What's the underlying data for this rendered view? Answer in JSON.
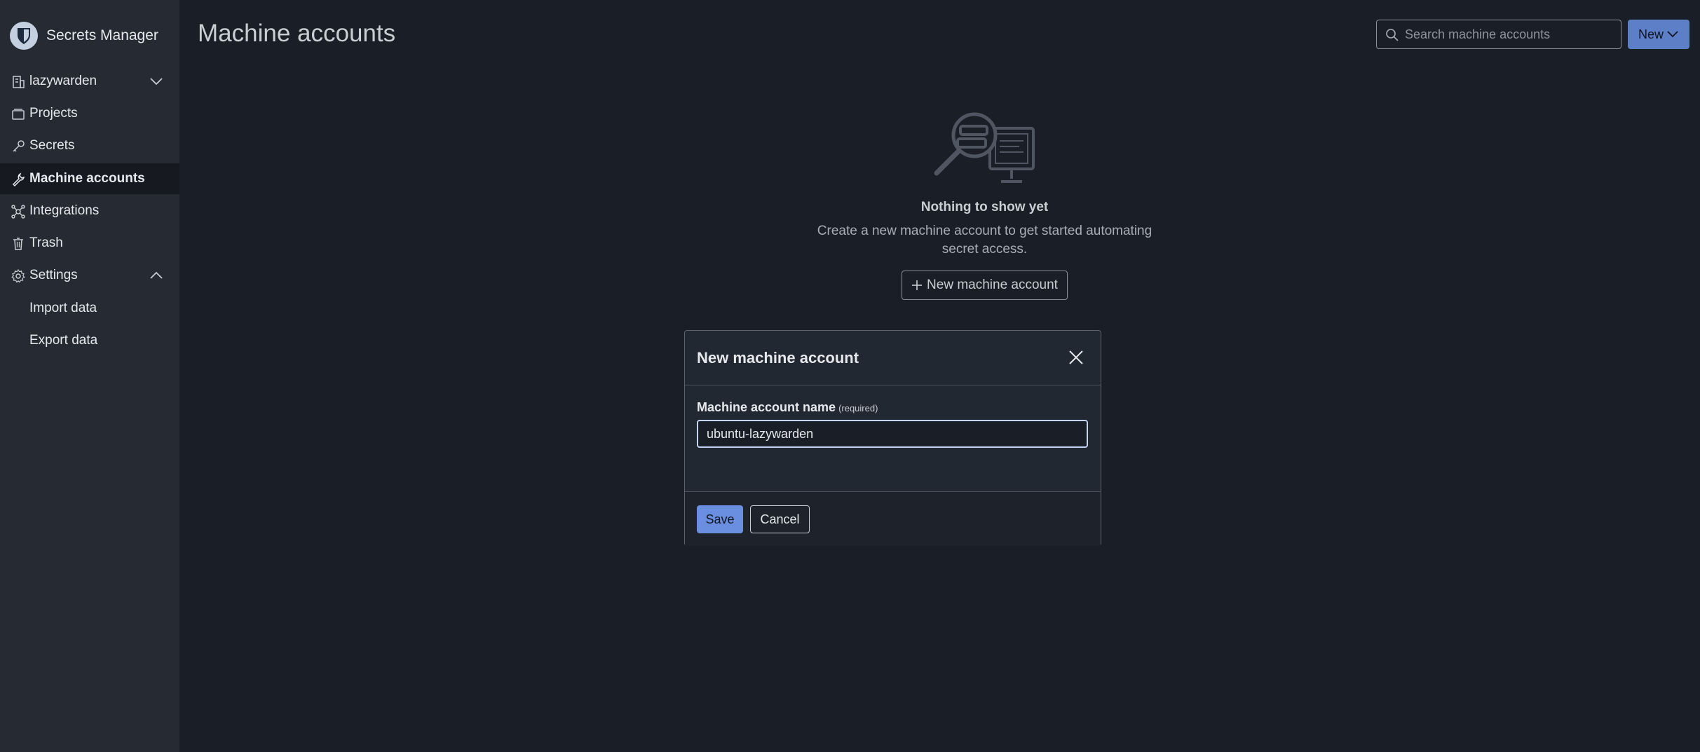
{
  "app": {
    "name": "Secrets Manager"
  },
  "sidebar": {
    "org": {
      "label": "lazywarden"
    },
    "items": [
      {
        "label": "Projects",
        "icon": "projects-icon"
      },
      {
        "label": "Secrets",
        "icon": "key-icon"
      },
      {
        "label": "Machine accounts",
        "icon": "wrench-icon",
        "active": true
      },
      {
        "label": "Integrations",
        "icon": "integrations-icon"
      },
      {
        "label": "Trash",
        "icon": "trash-icon"
      }
    ],
    "settings": {
      "label": "Settings",
      "expanded": true,
      "children": [
        {
          "label": "Import data"
        },
        {
          "label": "Export data"
        }
      ]
    }
  },
  "header": {
    "title": "Machine accounts",
    "search_placeholder": "Search machine accounts",
    "new_label": "New"
  },
  "empty_state": {
    "title": "Nothing to show yet",
    "description": "Create a new machine account to get started automating secret access.",
    "button_label": "New machine account"
  },
  "dialog": {
    "title": "New machine account",
    "field_label": "Machine account name",
    "field_required": "(required)",
    "field_value": "ubuntu-lazywarden",
    "save_label": "Save",
    "cancel_label": "Cancel"
  },
  "colors": {
    "background": "#1a1f27",
    "sidebar": "#262b33",
    "primary": "#6b8fe0"
  }
}
